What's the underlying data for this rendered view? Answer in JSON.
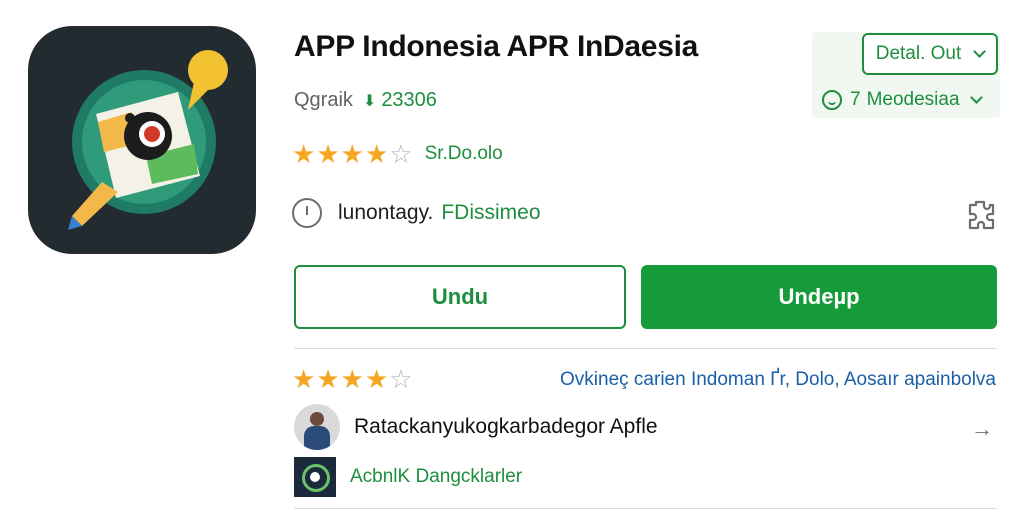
{
  "app": {
    "title": "APP Indonesia APR InDaesia",
    "developer": "Qgraik",
    "download_count": "23306",
    "rating_value": "Sr.Do.olo",
    "rating_stars": 4,
    "category_label": "lunontagy.",
    "category_value": "FDissimeo"
  },
  "dropdowns": {
    "detail_label": "Detal. Out",
    "language_count": "7",
    "language_label": "Meodesiaa"
  },
  "buttons": {
    "secondary_label": "Undu",
    "primary_label": "Undeµp"
  },
  "reviews": {
    "stars": 4,
    "link_text": "Ovkineç carien Indoman Ґr, Dolo, Aosaır apainbolva",
    "review_text": "Ratackanyukogkarbadegor Apfle",
    "source_text": "AcbnlK Dangcklarler"
  },
  "colors": {
    "accent_green": "#1e8e3e",
    "button_green": "#159b3a",
    "star_gold": "#f5a623",
    "link_blue": "#1a5fa8",
    "icon_bg": "#222b30"
  },
  "icons": {
    "app_icon": "photo-location-pencil-icon",
    "download": "download-icon",
    "clock": "clock-icon",
    "extension": "puzzle-icon",
    "language": "globe-icon",
    "next": "arrow-right-icon"
  }
}
